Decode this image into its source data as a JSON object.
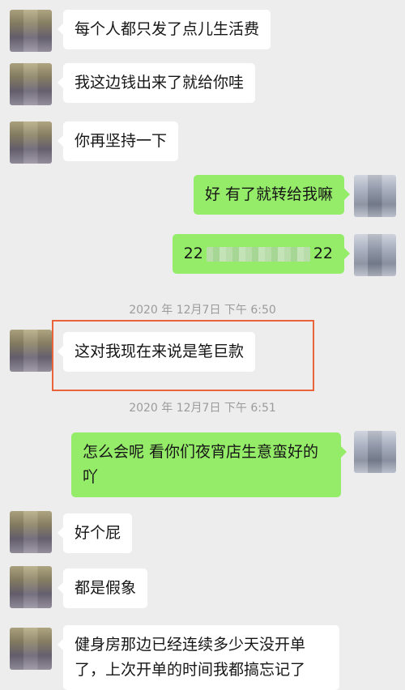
{
  "chat": {
    "messages": [
      {
        "side": "left",
        "text": "每个人都只发了点儿生活费"
      },
      {
        "side": "left",
        "text": "我这边钱出来了就给你哇"
      },
      {
        "side": "left",
        "text": "你再坚持一下"
      },
      {
        "side": "right",
        "text": "好   有了就转给我嘛"
      },
      {
        "side": "right",
        "text_prefix": "22",
        "text_suffix": "22"
      },
      {
        "side": "left",
        "text": "这对我现在来说是笔巨款"
      },
      {
        "side": "right",
        "text": "怎么会呢  看你们夜宵店生意蛮好的吖"
      },
      {
        "side": "left",
        "text": "好个屁"
      },
      {
        "side": "left",
        "text": "都是假象"
      },
      {
        "side": "left",
        "text": "健身房那边已经连续多少天没开单了，上次开单的时间我都搞忘记了"
      }
    ],
    "timestamps": [
      "2020 年 12月7日  下午 6:50",
      "2020 年 12月7日  下午 6:51"
    ]
  },
  "colors": {
    "background": "#ededed",
    "self_bubble": "#95ec69",
    "other_bubble": "#ffffff",
    "highlight_border": "#e9643a"
  }
}
